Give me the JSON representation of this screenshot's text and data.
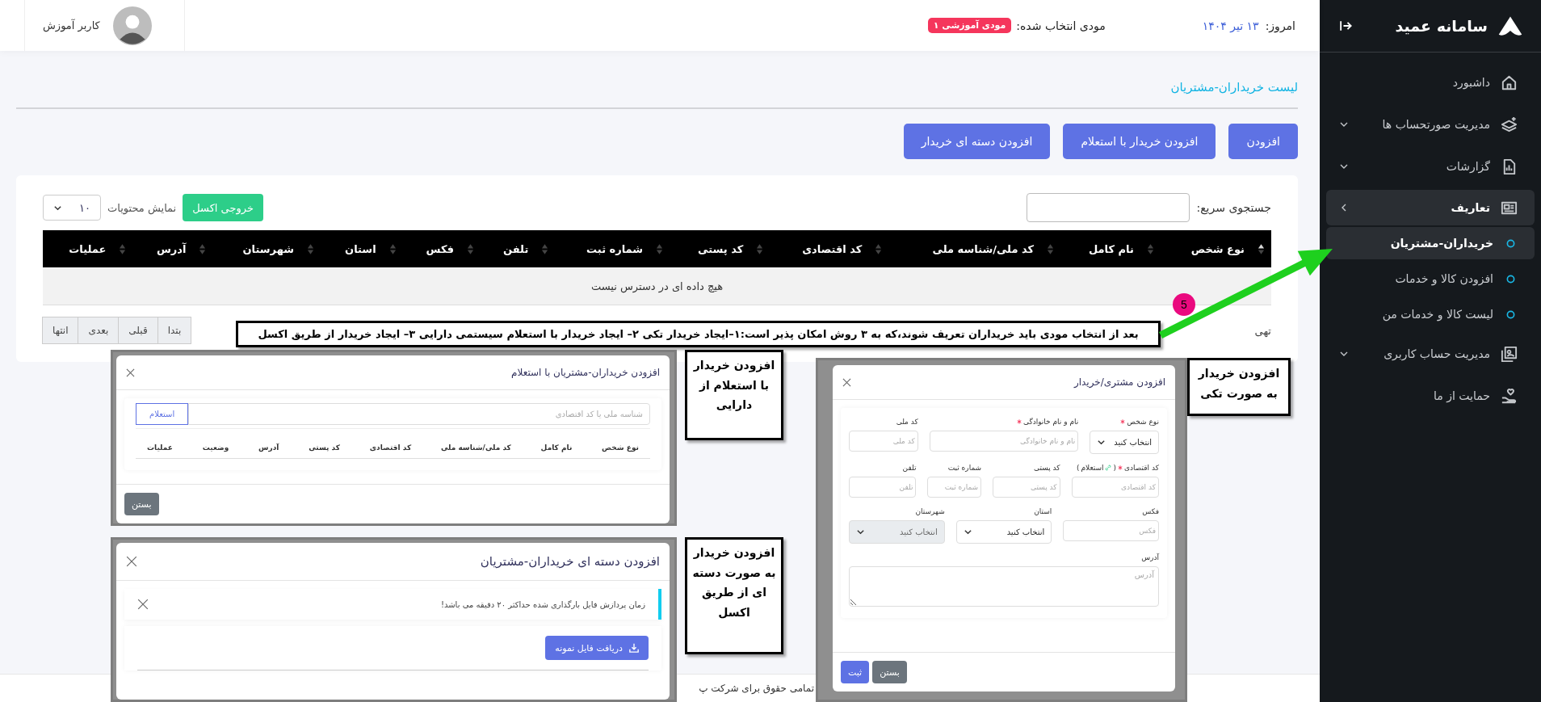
{
  "sidebar": {
    "brand": "سامانه عمید",
    "items": [
      {
        "label": "داشبورد",
        "selected": false
      },
      {
        "label": "مدیریت صورتحساب ها",
        "selected": false,
        "expanded": false
      },
      {
        "label": "گزارشات",
        "selected": false,
        "expanded": false
      },
      {
        "label": "تعاریف",
        "selected": false,
        "expanded": true,
        "children": [
          {
            "label": "خریداران-مشتریان",
            "selected": true
          },
          {
            "label": "افزودن کالا و خدمات",
            "selected": false
          },
          {
            "label": "لیست کالا و خدمات من",
            "selected": false
          }
        ]
      },
      {
        "label": "مدیریت حساب کاربری",
        "selected": false,
        "expanded": false
      },
      {
        "label": "حمایت از ما",
        "selected": false
      }
    ]
  },
  "header": {
    "date_label": "امروز:",
    "date": "۱۳ تیر ۱۴۰۴",
    "taxpayer_label": "مودی انتخاب شده:",
    "taxpayer": "مودی آموزشی ۱",
    "user_name": "کاربر آموزش"
  },
  "page": {
    "title": "لیست خریداران-مشتریان",
    "buttons": [
      "افزودن",
      "افزودن خریدار با استعلام",
      "افزودن دسته ای خریدار"
    ]
  },
  "table": {
    "search_label": "جستجوی سریع:",
    "export_button": "خروجی اکسل",
    "page_size_label": "نمایش محتویات",
    "page_size": "۱۰",
    "columns": [
      {
        "label": "نوع شخص",
        "sorted": true
      },
      {
        "label": "نام کامل",
        "sorted": false
      },
      {
        "label": "کد ملی/شناسه ملی",
        "sorted": false
      },
      {
        "label": "کد اقتصادی",
        "sorted": false
      },
      {
        "label": "کد پستی",
        "sorted": false
      },
      {
        "label": "شماره ثبت",
        "sorted": false
      },
      {
        "label": "تلفن",
        "sorted": false
      },
      {
        "label": "فکس",
        "sorted": false
      },
      {
        "label": "استان",
        "sorted": false
      },
      {
        "label": "شهرستان",
        "sorted": false
      },
      {
        "label": "آدرس",
        "sorted": false
      },
      {
        "label": "عملیات",
        "sorted": false
      }
    ],
    "empty_message": "هیچ داده ای در دسترس نیست",
    "info": "تهی",
    "pagination": [
      "بتدا",
      "قبلی",
      "بعدی",
      "انتها"
    ]
  },
  "annotations": {
    "step": "5",
    "summary": "بعد از انتخاب مودی باید خریداران تعریف شوند،که به ۳ روش امکان پذیر است:۱–ایجاد خریدار تکی ۲– ایجاد خریدار با استعلام سیستمی دارایی ۳– ایجاد خریدار از طریق اکسل",
    "notes": [
      "افزودن خریدار به صورت تکی",
      "افزودن خریدار با استعلام از دارایی",
      "افزودن خریدار به صورت دسته ای از طریق اکسل"
    ]
  },
  "single_modal": {
    "title": "افزودن مشتری/خریدار",
    "fields": [
      [
        {
          "kind": "select",
          "label": "نوع شخص",
          "required": true,
          "value": "انتخاب کنید",
          "disabled": false
        },
        {
          "kind": "input",
          "label": "نام و نام خانوادگی",
          "required": true,
          "placeholder": "نام و نام خانوادگی"
        },
        {
          "kind": "input",
          "label": "کد ملی",
          "required": false,
          "placeholder": "کد ملی"
        }
      ],
      [
        {
          "kind": "input",
          "label": "کد اقتصادی",
          "required": true,
          "link": {
            "open": "(",
            "text": "استعلام",
            "close": ")"
          },
          "placeholder": "کد اقتصادی"
        },
        {
          "kind": "input",
          "label": "کد پستی",
          "required": false,
          "placeholder": "کد پستی"
        },
        {
          "kind": "input",
          "label": "شماره ثبت",
          "required": false,
          "placeholder": "شماره ثبت"
        },
        {
          "kind": "input",
          "label": "تلفن",
          "required": false,
          "placeholder": "تلفن"
        }
      ],
      [
        {
          "kind": "input",
          "label": "فکس",
          "required": false,
          "placeholder": "فکس"
        },
        {
          "kind": "select",
          "label": "استان",
          "required": false,
          "value": "انتخاب کنید",
          "disabled": false
        },
        {
          "kind": "select",
          "label": "شهرستان",
          "required": false,
          "value": "انتخاب کنید",
          "disabled": true
        }
      ],
      [
        {
          "kind": "textarea",
          "label": "آدرس",
          "required": false,
          "placeholder": "آدرس"
        }
      ]
    ],
    "buttons": [
      {
        "label": "بستن",
        "kind": "secondary"
      },
      {
        "label": "ثبت",
        "kind": "primary"
      }
    ]
  },
  "enquiry_modal": {
    "title": "افزودن خریداران-مشتریان با استعلام",
    "placeholder": "شناسه ملی یا کد اقتصادی",
    "enquiry_button": "استعلام",
    "columns": [
      "نوع شخص",
      "نام کامل",
      "کد ملی/شناسه ملی",
      "کد اقتصادی",
      "کد پستی",
      "آدرس",
      "وضعیت",
      "عملیات"
    ],
    "buttons": [
      {
        "label": "بستن",
        "kind": "secondary"
      }
    ]
  },
  "batch_modal": {
    "title": "افزودن دسته ای خریداران-مشتریان",
    "notice": "زمان پردازش فایل بارگذاری شده حداکثر ۲۰ دقیقه می باشد!",
    "download_button": "دریافت فایل نمونه"
  },
  "footer": {
    "copyright": "تمامی حقوق برای شرکت پ"
  }
}
